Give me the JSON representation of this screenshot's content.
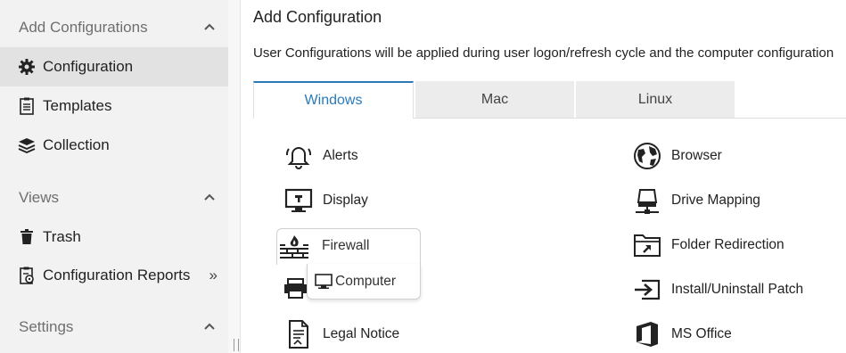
{
  "sidebar": {
    "sections": [
      {
        "title": "Add Configurations",
        "items": [
          {
            "label": "Configuration",
            "icon": "gear-icon",
            "active": true
          },
          {
            "label": "Templates",
            "icon": "clipboard-icon"
          },
          {
            "label": "Collection",
            "icon": "layers-icon"
          }
        ]
      },
      {
        "title": "Views",
        "items": [
          {
            "label": "Trash",
            "icon": "trash-icon"
          },
          {
            "label": "Configuration Reports",
            "icon": "report-icon",
            "suffix": "»"
          }
        ]
      },
      {
        "title": "Settings",
        "items": []
      }
    ]
  },
  "main": {
    "title": "Add Configuration",
    "info": "User Configurations will be applied during user logon/refresh cycle and the computer configuration",
    "tabs": [
      {
        "label": "Windows",
        "active": true
      },
      {
        "label": "Mac"
      },
      {
        "label": "Linux"
      }
    ],
    "left_items": [
      "Alerts",
      "Display",
      "Firewall",
      "Legal Notice"
    ],
    "right_items": [
      "Browser",
      "Drive Mapping",
      "Folder Redirection",
      "Install/Uninstall Patch",
      "MS Office"
    ],
    "popup": {
      "title": "Firewall",
      "option": "Computer"
    }
  },
  "colors": {
    "accent": "#2a7ab8",
    "sidebar_bg": "#f2f2f2",
    "active_bg": "#e2e2e2"
  }
}
